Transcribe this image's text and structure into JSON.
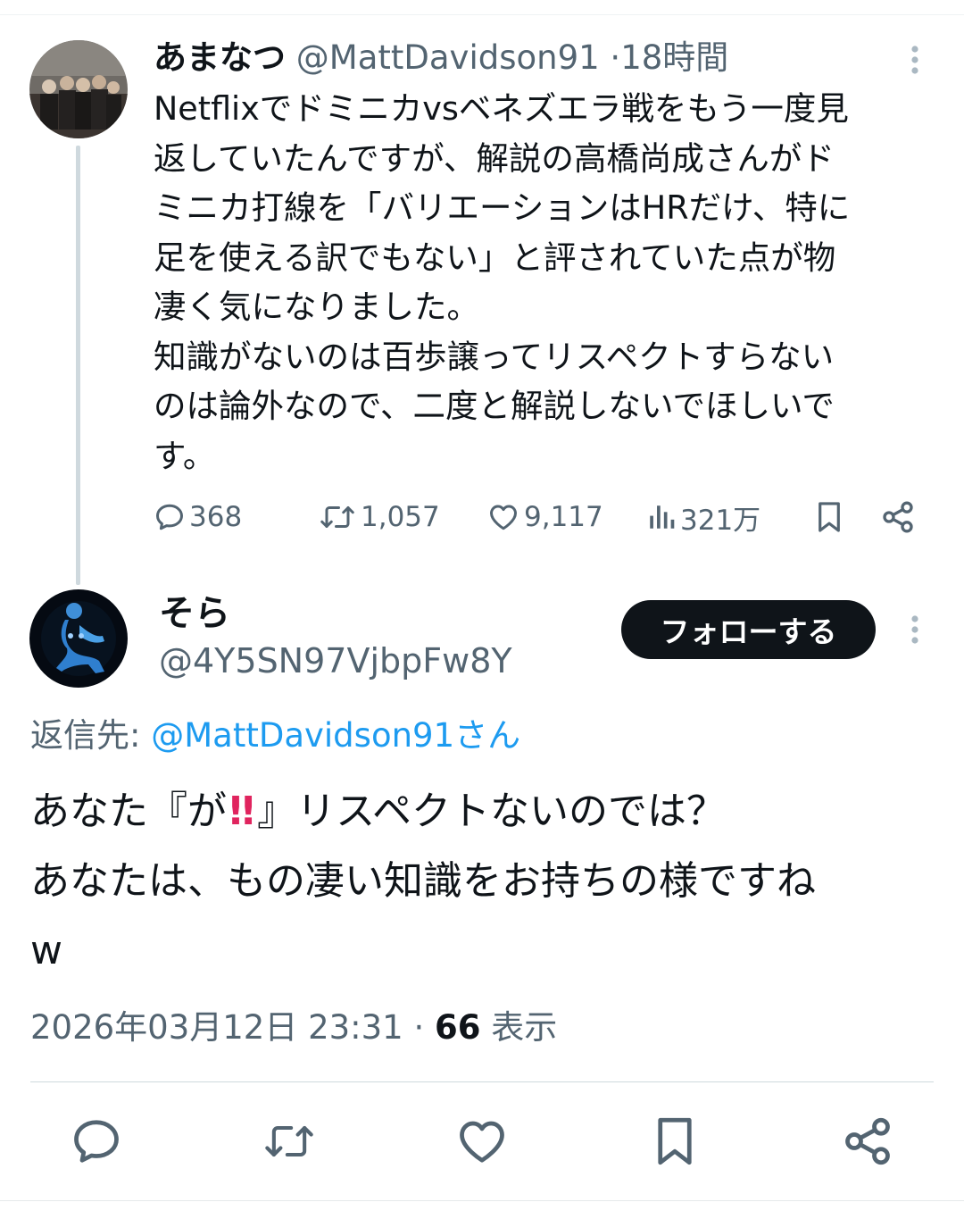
{
  "parent_tweet": {
    "display_name": "あまなつ",
    "handle": "@MattDavidson91",
    "separator": "·",
    "time_ago": "18時間",
    "text_lines": [
      "Netflixでドミニカvsベネズエラ戦をもう一度見",
      "返していたんですが、解説の高橋尚成さんがド",
      "ミニカ打線を「バリエーションはHRだけ、特に",
      "足を使える訳でもない」と評されていた点が物",
      "凄く気になりました。",
      "知識がないのは百歩譲ってリスペクトすらない",
      "のは論外なので、二度と解説しないでほしいで",
      "す。"
    ],
    "replies": "368",
    "retweets": "1,057",
    "likes": "9,117",
    "views": "321万"
  },
  "reply_tweet": {
    "display_name": "そら",
    "handle": "@4Y5SN97VjbpFw8Y",
    "follow_label": "フォローする",
    "reply_to_prefix": "返信先:",
    "reply_to_target": "@MattDavidson91さん",
    "text": {
      "line1_before": "あなた『が",
      "emoji": "!!",
      "line1_after": "』リスペクトないのでは？",
      "line2": "あなたは、もの凄い知識をお持ちの様ですね",
      "line3": "w"
    },
    "timestamp": "2026年03月12日 23:31",
    "separator": "·",
    "view_count": "66",
    "view_label": "表示"
  },
  "icons": {
    "reply": "speech-bubble-icon",
    "retweet": "retweet-arrows-icon",
    "like": "heart-icon",
    "views": "bar-chart-icon",
    "bookmark": "bookmark-icon",
    "share": "share-nodes-icon",
    "more": "vertical-dots-icon"
  },
  "colors": {
    "text": "#0f1419",
    "muted": "#536471",
    "link": "#1d9bf0",
    "follow_button": "#0f1419",
    "emoji_red": "#e0245e"
  }
}
